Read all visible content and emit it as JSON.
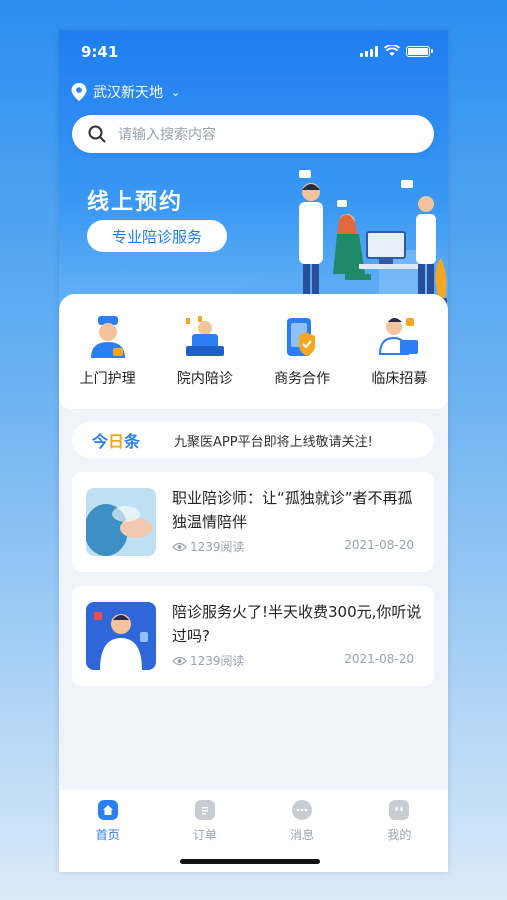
{
  "status_bar": {
    "time": "9:41"
  },
  "location": {
    "city": "武汉新天地"
  },
  "search": {
    "placeholder": "请输入搜索内容"
  },
  "banner": {
    "title": "线上预约",
    "subtitle": "专业陪诊服务"
  },
  "services": [
    {
      "label": "上门护理",
      "icon": "nurse-icon"
    },
    {
      "label": "院内陪诊",
      "icon": "hospital-bed-icon"
    },
    {
      "label": "商务合作",
      "icon": "cooperation-icon"
    },
    {
      "label": "临床招募",
      "icon": "clinical-recruit-icon"
    }
  ],
  "notice": {
    "tag_a": "今",
    "tag_b": "日",
    "tag_c": "条",
    "text": "九聚医APP平台即将上线敬请关注!"
  },
  "articles": [
    {
      "title": "职业陪诊师：让“孤独就诊”者不再孤独温情陪伴",
      "views": "1239阅读",
      "date": "2021-08-20"
    },
    {
      "title": "陪诊服务火了!半天收费300元,你听说过吗?",
      "views": "1239阅读",
      "date": "2021-08-20"
    }
  ],
  "tabbar": [
    {
      "label": "首页",
      "active": true,
      "icon": "home-icon"
    },
    {
      "label": "订单",
      "active": false,
      "icon": "order-icon"
    },
    {
      "label": "消息",
      "active": false,
      "icon": "message-icon"
    },
    {
      "label": "我的",
      "active": false,
      "icon": "profile-icon"
    }
  ],
  "colors": {
    "primary": "#2b7ff0",
    "accent": "#f6a623",
    "background": "#f0f4fa"
  }
}
